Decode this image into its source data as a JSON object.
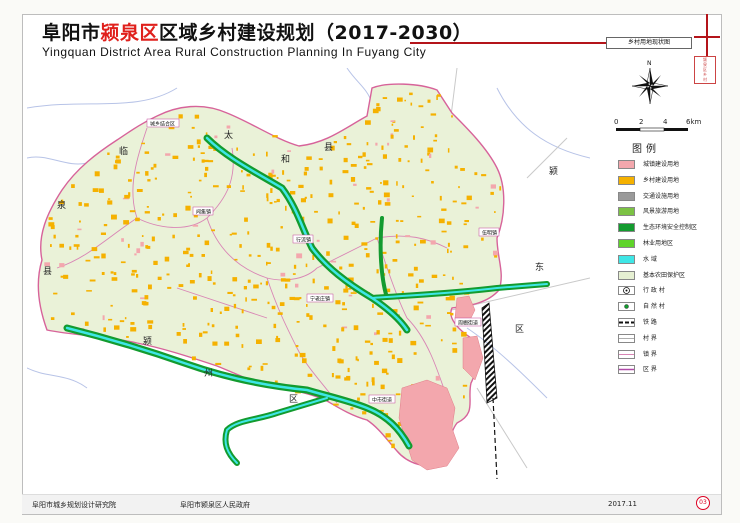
{
  "title": {
    "cn_prefix": "阜阳市",
    "cn_highlight": "颍泉区",
    "cn_suffix": "区域乡村建设规划（2017-2030）",
    "en": "Yingquan District Area Rural Construction Planning In Fuyang City"
  },
  "sheet_label": "乡村用地现状图",
  "thumb_text": [
    "颍",
    "泉",
    "区",
    "乡",
    "村"
  ],
  "compass_label": "N",
  "scale": {
    "ticks": [
      "0",
      "2",
      "4",
      "6km"
    ]
  },
  "legend": {
    "title": "图例",
    "items": [
      {
        "label": "城镇建设用地",
        "color": "#f3a7ad"
      },
      {
        "label": "乡村建设用地",
        "color": "#f5b100"
      },
      {
        "label": "交通设施用地",
        "color": "#9a9a9a"
      },
      {
        "label": "风景旅游用地",
        "color": "#7cc244"
      },
      {
        "label": "生态环境安全控制区",
        "color": "#139b2f"
      },
      {
        "label": "林业用地区",
        "color": "#5fd42a"
      },
      {
        "label": "水 域",
        "color": "#3ee6e6"
      },
      {
        "label": "基本农田保护区",
        "color": "#e6f0d2"
      },
      {
        "label": "行 政 村",
        "color": "#ffffff"
      },
      {
        "label": "自 然 村",
        "color": "#ffffff"
      },
      {
        "label": "铁 路",
        "color": "#ffffff"
      },
      {
        "label": "村 界",
        "color": "#ffffff"
      },
      {
        "label": "镇 界",
        "color": "#ffffff"
      },
      {
        "label": "区 界",
        "color": "#ffffff"
      }
    ]
  },
  "map": {
    "town_labels": [
      "城乡结合区",
      "闻集镇",
      "行流镇",
      "宁老庄镇",
      "伍明镇",
      "周棚街道",
      "中市街道"
    ],
    "neighbor_chars": [
      "太",
      "和",
      "县",
      "临",
      "泉",
      "县",
      "颍",
      "东",
      "区",
      "颍",
      "州",
      "区"
    ]
  },
  "footer": {
    "left": "阜阳市城乡规划设计研究院",
    "middle": "阜阳市颍泉区人民政府",
    "date": "2017.11",
    "page": "03"
  },
  "colors": {
    "accent": "#b4141a",
    "district_fill": "#eaf2d8",
    "village": "#f5b100",
    "urban": "#f3a7ad",
    "water": "#3ee6e6",
    "ecology": "#139b2f"
  }
}
